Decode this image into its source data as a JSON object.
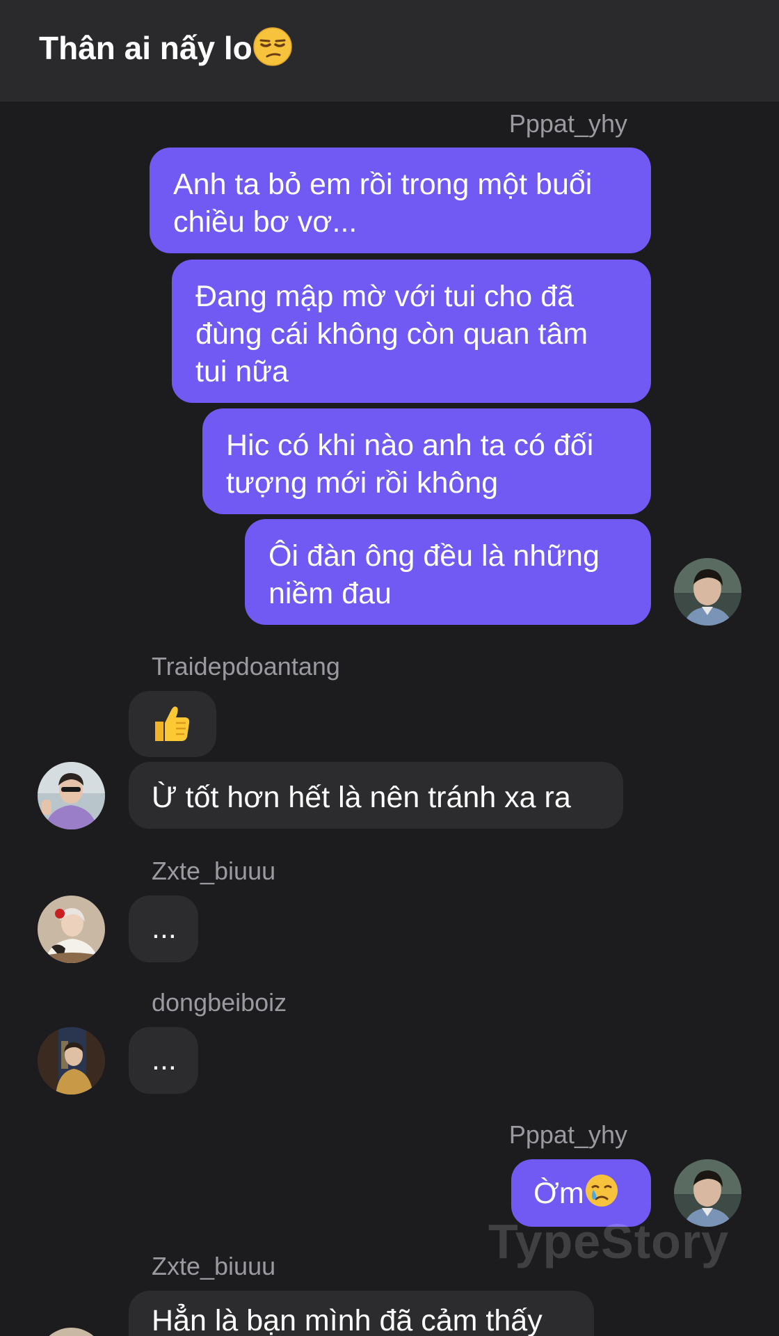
{
  "header": {
    "title": "Thân ai nấy lo",
    "title_emoji": "unamused-face-emoji"
  },
  "messages": [
    {
      "sender": "Pppat_yhy",
      "direction": "out",
      "bubbles": [
        "Anh ta bỏ em rồi trong một buổi chiều bơ vơ...",
        "Đang mập mờ với tui cho đã đùng cái không còn quan tâm tui nữa",
        "Hic có khi nào anh ta có đối tượng mới rồi không",
        "Ôi đàn ông đều là những niềm đau"
      ],
      "avatar": "avatar-pppat-yhy"
    },
    {
      "sender": "Traidepdoantang",
      "direction": "in",
      "bubbles": [
        "👍",
        "Ừ tốt hơn hết là nên tránh xa ra"
      ],
      "avatar": "avatar-traidepdoantang"
    },
    {
      "sender": "Zxte_biuuu",
      "direction": "in",
      "bubbles": [
        "..."
      ],
      "avatar": "avatar-zxte-biuuu"
    },
    {
      "sender": "dongbeiboiz",
      "direction": "in",
      "bubbles": [
        "..."
      ],
      "avatar": "avatar-dongbeiboiz"
    },
    {
      "sender": "Pppat_yhy",
      "direction": "out",
      "bubbles": [
        "Ờm"
      ],
      "bubble_emoji": "crying-face-emoji",
      "avatar": "avatar-pppat-yhy"
    },
    {
      "sender": "Zxte_biuuu",
      "direction": "in",
      "bubbles": [
        "Hẳn là bạn mình đã cảm thấy"
      ],
      "avatar": "avatar-zxte-biuuu"
    }
  ],
  "watermark": "TypeStory",
  "colors": {
    "background": "#1c1c1e",
    "header": "#2a2a2c",
    "outgoing_bubble": "#7159f4",
    "incoming_bubble": "#2c2c2e",
    "sender_name": "#9a9aa0"
  }
}
